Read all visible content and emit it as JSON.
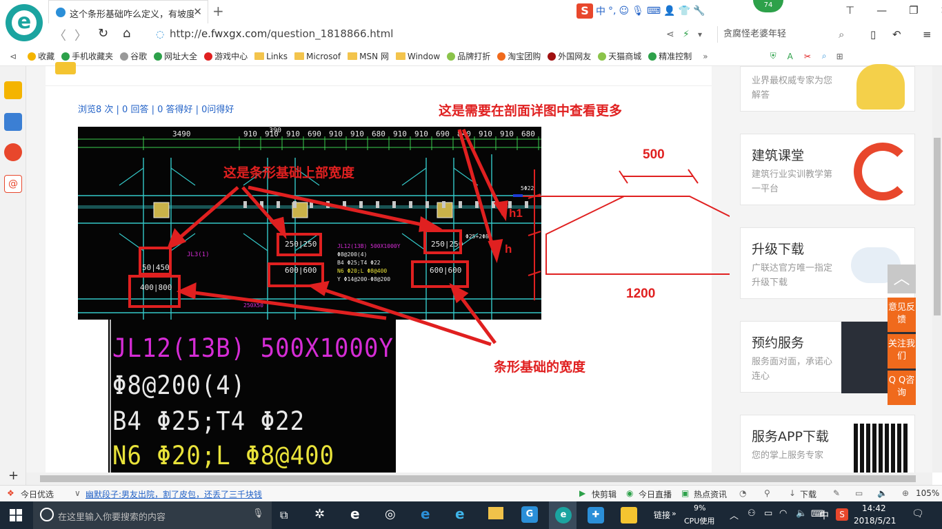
{
  "browser": {
    "tab_title": "这个条形基础咋么定义，有坡度",
    "new_tab": "+",
    "url_prefix": "http://",
    "url_domain": "e.fwxgx.com",
    "url_path": "/question_1818866.html",
    "search_text": "贪腐怪老婆年轻",
    "badge": "74",
    "ext_labels": [
      "中",
      "°,"
    ],
    "window_controls": [
      "⊤",
      "—",
      "❐",
      "✕"
    ]
  },
  "bookmarks": [
    {
      "label": "收藏",
      "icon": "star-icon"
    },
    {
      "label": "手机收藏夹",
      "icon": "phone-icon"
    },
    {
      "label": "谷歌",
      "icon": "page-icon"
    },
    {
      "label": "网址大全",
      "icon": "globe-icon"
    },
    {
      "label": "游戏中心",
      "icon": "game-icon"
    },
    {
      "label": "Links",
      "icon": "folder-icon"
    },
    {
      "label": "Microsof",
      "icon": "folder-icon"
    },
    {
      "label": "MSN 网",
      "icon": "folder-icon"
    },
    {
      "label": "Window",
      "icon": "folder-icon"
    },
    {
      "label": "品牌打折",
      "icon": "leaf-icon"
    },
    {
      "label": "淘宝团购",
      "icon": "taobao-icon"
    },
    {
      "label": "外国网友",
      "icon": "flag-icon"
    },
    {
      "label": "天猫商城",
      "icon": "leaf-icon"
    },
    {
      "label": "精准控制",
      "icon": "chat-icon"
    }
  ],
  "question": {
    "stats": "浏览8 次 | 0 回答 | 0 答得好 | 0问得好"
  },
  "cad": {
    "dims_top": [
      "3490",
      "910",
      "910",
      "910",
      "690",
      "910",
      "910",
      "680",
      "910",
      "910",
      "690",
      "840",
      "910",
      "910",
      "680",
      "910"
    ],
    "dims_top_2": "390",
    "beam_labels": {
      "a": "50|450",
      "b": "400|800",
      "c": "250|250",
      "d": "600|600",
      "e": "250|250",
      "f": "600|600",
      "jl": "JL3(1)",
      "jl12": "JL12(13B) 500X1000Y",
      "r1": "Φ8@200(4)",
      "r2": "B4 Φ25;T4 Φ22",
      "r3": "N6 Φ20;L Φ8@400",
      "r4": "Y Φ14@200-Φ8@200",
      "r5": "Φ25+2Φ8",
      "r6": "5Φ22",
      "r7": "250X50"
    },
    "zoom": {
      "line1": "JL12(13B) 500X1000Y",
      "line2": "Φ8@200(4)",
      "line3": "B4 Φ25;T4 Φ22",
      "line4": "N6 Φ20;L Φ8@400"
    }
  },
  "annotations": {
    "top_width": "这是条形基础上部宽度",
    "section_detail": "这是需要在剖面详图中查看更多",
    "base_width": "条形基础的宽度",
    "dim_500": "500",
    "dim_1200": "1200",
    "h1": "h1",
    "h": "h"
  },
  "cards": [
    {
      "title": "",
      "desc": "业界最权威专家为您解答"
    },
    {
      "title": "建筑课堂",
      "desc": "建筑行业实训教学第一平台"
    },
    {
      "title": "升级下载",
      "desc": "广联达官方唯一指定升级下载"
    },
    {
      "title": "预约服务",
      "desc": "服务面对面，承诺心连心"
    },
    {
      "title": "服务APP下载",
      "desc": "您的掌上服务专家"
    }
  ],
  "float": {
    "feedback": "意见反馈",
    "follow": "关注我们",
    "qq": "Q Q咨询"
  },
  "statusbar": {
    "left": "今日优选",
    "news": "幽默段子:男友出院，割了皮包，还丢了三千块钱",
    "items": [
      "快剪辑",
      "今日直播",
      "热点资讯"
    ],
    "download": "下载",
    "zoom": "105%"
  },
  "taskbar": {
    "search_placeholder": "在这里输入你要搜索的内容",
    "tray": [
      "链接"
    ],
    "cpu": "9%",
    "cpu_label": "CPU使用",
    "ime": "中",
    "time": "14:42",
    "date": "2018/5/21"
  },
  "colors": {
    "accent_red": "#e02020",
    "link_blue": "#2463c7",
    "float_orange": "#f06a1c",
    "cad_bg": "#050505",
    "cad_cyan": "#34c9c9",
    "cad_magenta": "#d52cd5",
    "cad_yellow": "#e8e23a"
  }
}
